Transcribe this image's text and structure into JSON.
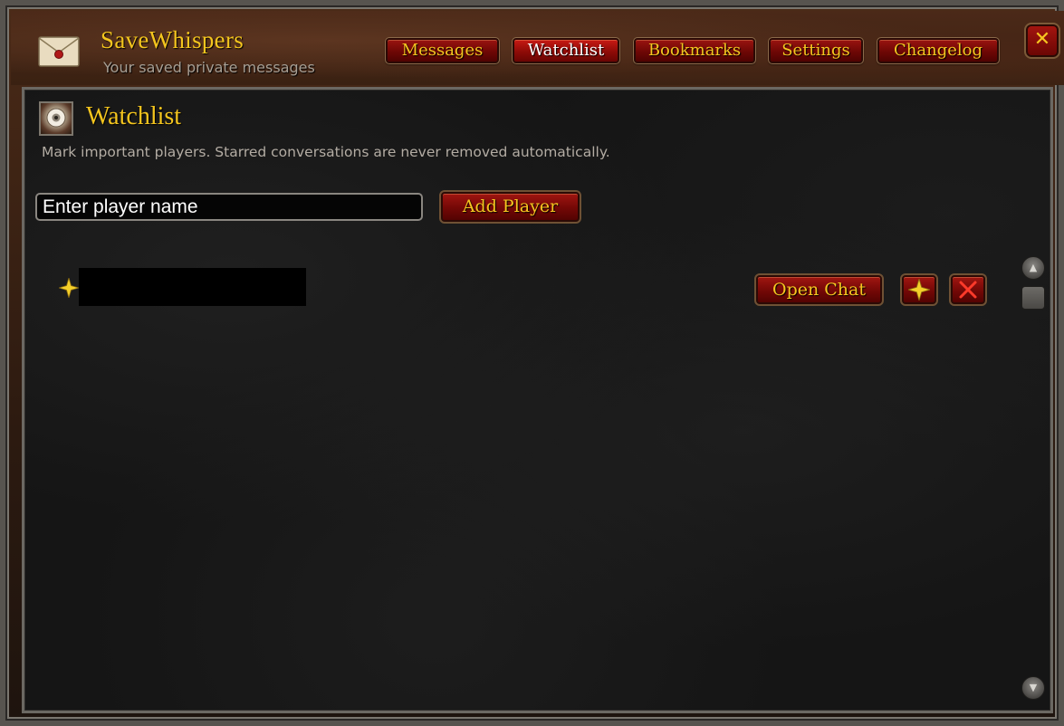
{
  "app": {
    "title": "SaveWhispers",
    "subtitle": "Your saved private messages",
    "close_label": "✕"
  },
  "tabs": [
    {
      "label": "Messages",
      "active": false
    },
    {
      "label": "Watchlist",
      "active": true
    },
    {
      "label": "Bookmarks",
      "active": false
    },
    {
      "label": "Settings",
      "active": false
    },
    {
      "label": "Changelog",
      "active": false
    }
  ],
  "section": {
    "title": "Watchlist",
    "description": "Mark important players. Starred conversations are never removed automatically."
  },
  "add_player": {
    "placeholder": "Enter player name",
    "button_label": "Add Player"
  },
  "watchlist_rows": [
    {
      "starred": true,
      "name_redacted": true,
      "open_chat_label": "Open Chat"
    }
  ],
  "icons": {
    "envelope": "envelope-icon",
    "section": "eye-icon",
    "star": "star-icon",
    "remove": "close-icon",
    "scroll_up": "chevron-up-icon",
    "scroll_down": "chevron-down-icon"
  },
  "colors": {
    "gold_text": "#f4c51e",
    "button_red": "#8e0b07",
    "panel_bg": "#151515",
    "header_bg": "#4b2918"
  }
}
